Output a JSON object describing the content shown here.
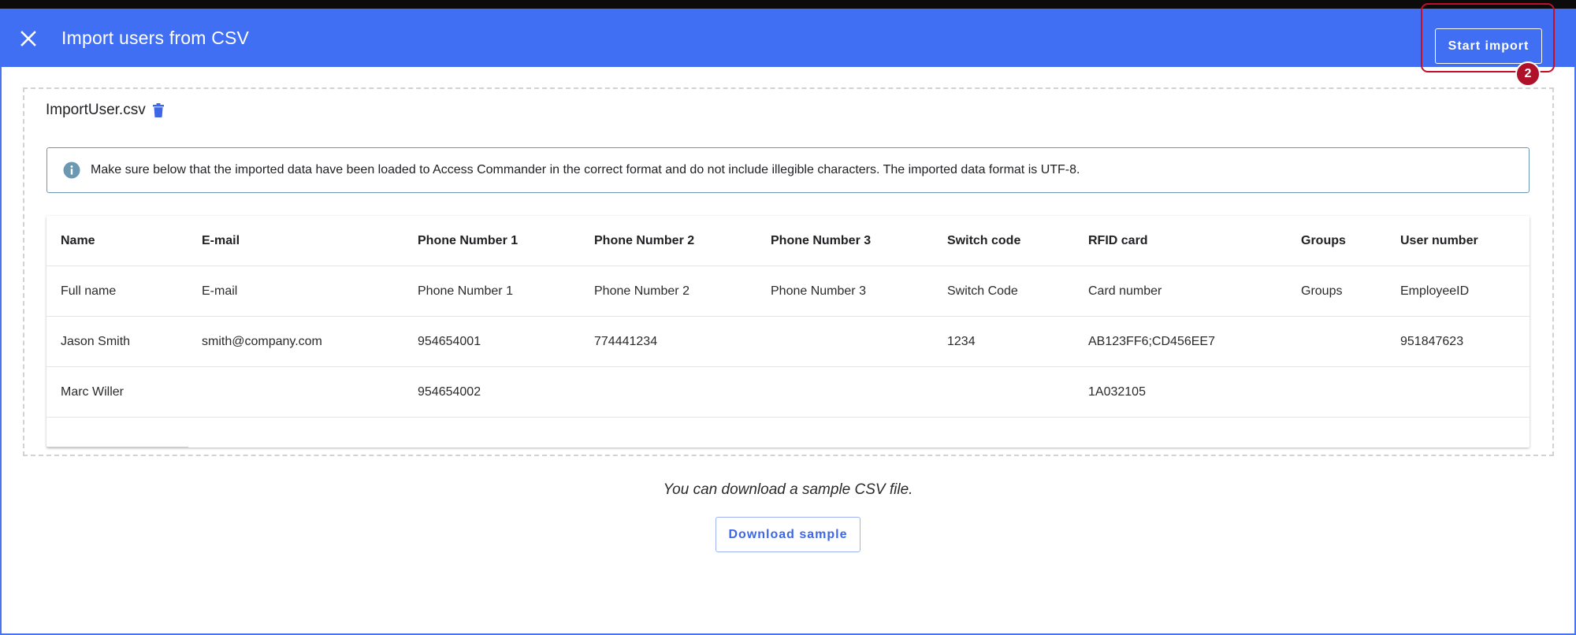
{
  "header": {
    "title": "Import users from CSV",
    "start_import_label": "Start import",
    "step_badge": "2"
  },
  "file": {
    "name": "ImportUser.csv"
  },
  "info": {
    "text": "Make sure below that the imported data have been loaded to Access Commander in the correct format and do not include illegible characters. The imported data format is UTF-8."
  },
  "table": {
    "columns": [
      "Name",
      "E-mail",
      "Phone Number 1",
      "Phone Number 2",
      "Phone Number 3",
      "Switch code",
      "RFID card",
      "Groups",
      "User number"
    ],
    "rows": [
      [
        "Full name",
        "E-mail",
        "Phone Number 1",
        "Phone Number 2",
        "Phone Number 3",
        "Switch Code",
        "Card number",
        "Groups",
        "EmployeeID"
      ],
      [
        "Jason Smith",
        "smith@company.com",
        "954654001",
        "774441234",
        "",
        "1234",
        "AB123FF6;CD456EE7",
        "",
        "951847623"
      ],
      [
        "Marc Willer",
        "",
        "954654002",
        "",
        "",
        "",
        "1A032105",
        "",
        ""
      ]
    ]
  },
  "sample": {
    "text": "You can download a sample CSV file.",
    "download_label": "Download sample"
  },
  "colors": {
    "header_bg": "#416ff4",
    "accent": "#3d67e6",
    "highlight": "#c2102c",
    "info_border": "#6b99b2"
  }
}
